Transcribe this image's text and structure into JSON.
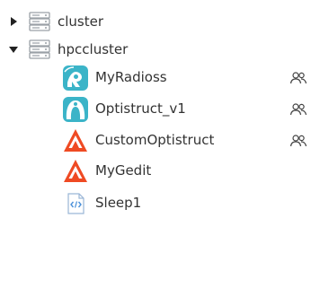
{
  "tree": {
    "nodes": [
      {
        "label": "cluster",
        "expanded": false,
        "toggle_icon": "caret-right-icon",
        "icon": "server-icon"
      },
      {
        "label": "hpccluster",
        "expanded": true,
        "toggle_icon": "caret-down-icon",
        "icon": "server-icon",
        "children": [
          {
            "label": "MyRadioss",
            "icon": "radioss-icon",
            "shared": true
          },
          {
            "label": "Optistruct_v1",
            "icon": "optistruct-icon",
            "shared": true
          },
          {
            "label": "CustomOptistruct",
            "icon": "altair-logo-icon",
            "shared": true
          },
          {
            "label": "MyGedit",
            "icon": "altair-logo-icon",
            "shared": false
          },
          {
            "label": "Sleep1",
            "icon": "script-icon",
            "shared": false
          }
        ]
      }
    ]
  },
  "colors": {
    "text": "#333333",
    "caret": "#222222",
    "server_icon": "#9aa0a6",
    "radioss_teal": "#3bb4c8",
    "altair_orange": "#ef4a23",
    "script_blue": "#4a90d9",
    "shared_icon": "#444444"
  }
}
